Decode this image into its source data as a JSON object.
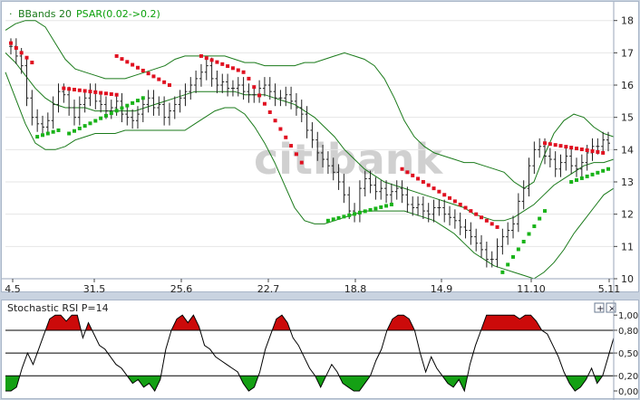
{
  "legend": {
    "dot": "·",
    "bbands_label": "BBands 20",
    "psar_label": "PSAR(0.02->0.2)",
    "bbands_color": "#1a7a1a",
    "psar_color": "#0aa00a"
  },
  "watermark": "citibank",
  "osc_title": "Stochastic RSI P=14",
  "osc_buttons": [
    "+",
    "×"
  ],
  "chart_data": [
    {
      "type": "candlestick",
      "indicators": [
        "Bollinger Bands (20)",
        "Parabolic SAR (0.02->0.2)"
      ],
      "x_ticks": [
        "4.5",
        "31.5",
        "25.6",
        "22.7",
        "18.8",
        "14.9",
        "11.10",
        "5.11"
      ],
      "y_ticks": [
        10,
        11,
        12,
        13,
        14,
        15,
        16,
        17,
        18
      ],
      "ylim": [
        10,
        18.3
      ],
      "grid": false,
      "colors": {
        "band": "#1a7a1a",
        "bar": "#222222",
        "psar_above": "#e01020",
        "psar_below": "#19b319",
        "grid": "#e6e6e6"
      },
      "price": [
        17.2,
        16.9,
        16.6,
        15.6,
        15.0,
        14.8,
        14.7,
        14.9,
        15.4,
        15.8,
        15.7,
        15.3,
        15.0,
        15.4,
        15.6,
        15.8,
        15.5,
        15.4,
        15.2,
        15.3,
        15.5,
        15.1,
        15.0,
        14.9,
        15.1,
        15.4,
        15.6,
        15.3,
        15.4,
        15.0,
        15.2,
        15.4,
        15.6,
        15.8,
        16.0,
        16.2,
        16.4,
        16.6,
        16.2,
        16.0,
        16.1,
        15.9,
        15.9,
        16.0,
        15.8,
        15.7,
        15.7,
        15.9,
        16.0,
        15.8,
        15.6,
        15.6,
        15.7,
        15.5,
        15.3,
        15.1,
        14.6,
        14.3,
        13.9,
        13.7,
        13.5,
        13.3,
        13.0,
        12.6,
        12.1,
        12.0,
        12.8,
        13.1,
        12.9,
        12.7,
        12.8,
        12.6,
        12.7,
        12.8,
        12.6,
        12.3,
        12.2,
        12.3,
        12.1,
        12.0,
        12.2,
        12.2,
        12.0,
        11.9,
        11.8,
        11.6,
        11.5,
        11.3,
        11.1,
        10.9,
        10.6,
        10.6,
        11.0,
        11.3,
        11.5,
        11.7,
        12.4,
        12.8,
        13.5,
        14.0,
        14.1,
        13.8,
        13.7,
        13.4,
        13.6,
        13.8,
        13.5,
        13.4,
        13.6,
        13.9,
        14.1,
        14.1,
        14.3,
        14.2
      ],
      "upper_band": [
        17.7,
        17.9,
        18.0,
        18.0,
        17.8,
        17.3,
        16.8,
        16.5,
        16.4,
        16.3,
        16.2,
        16.2,
        16.2,
        16.3,
        16.4,
        16.5,
        16.6,
        16.8,
        16.9,
        16.9,
        16.9,
        16.9,
        16.9,
        16.8,
        16.7,
        16.7,
        16.6,
        16.6,
        16.6,
        16.6,
        16.7,
        16.7,
        16.8,
        16.9,
        17.0,
        16.9,
        16.8,
        16.6,
        16.2,
        15.6,
        14.9,
        14.4,
        14.1,
        13.9,
        13.8,
        13.7,
        13.6,
        13.6,
        13.5,
        13.4,
        13.3,
        13.0,
        12.8,
        13.0,
        13.8,
        14.5,
        14.9,
        15.1,
        15.0,
        14.7,
        14.5,
        14.4
      ],
      "middle_band": [
        17.0,
        16.7,
        16.3,
        15.9,
        15.6,
        15.4,
        15.3,
        15.3,
        15.3,
        15.2,
        15.2,
        15.2,
        15.2,
        15.2,
        15.3,
        15.4,
        15.5,
        15.6,
        15.7,
        15.8,
        15.8,
        15.8,
        15.8,
        15.8,
        15.7,
        15.7,
        15.7,
        15.6,
        15.5,
        15.4,
        15.2,
        15.0,
        14.7,
        14.4,
        14.0,
        13.7,
        13.4,
        13.2,
        13.0,
        12.9,
        12.8,
        12.7,
        12.6,
        12.5,
        12.4,
        12.3,
        12.2,
        12.0,
        11.9,
        11.8,
        11.8,
        11.9,
        12.1,
        12.3,
        12.6,
        12.9,
        13.1,
        13.3,
        13.5,
        13.6,
        13.6,
        13.7
      ],
      "lower_band": [
        16.4,
        15.6,
        14.8,
        14.2,
        14.0,
        14.0,
        14.1,
        14.3,
        14.4,
        14.5,
        14.5,
        14.5,
        14.6,
        14.6,
        14.6,
        14.6,
        14.6,
        14.6,
        14.6,
        14.8,
        15.0,
        15.2,
        15.3,
        15.3,
        15.1,
        14.7,
        14.2,
        13.6,
        12.9,
        12.2,
        11.8,
        11.7,
        11.7,
        11.8,
        11.9,
        12.0,
        12.1,
        12.1,
        12.1,
        12.1,
        12.1,
        12.0,
        11.9,
        11.8,
        11.6,
        11.4,
        11.1,
        10.8,
        10.6,
        10.4,
        10.3,
        10.2,
        10.1,
        10.0,
        10.2,
        10.5,
        10.9,
        11.4,
        11.8,
        12.2,
        12.6,
        12.8
      ],
      "psar": [
        {
          "start": 0,
          "end": 4,
          "side": "above",
          "from": 17.3,
          "to": 16.7
        },
        {
          "start": 5,
          "end": 9,
          "side": "below",
          "from": 14.4,
          "to": 14.6
        },
        {
          "start": 10,
          "end": 20,
          "side": "above",
          "from": 15.9,
          "to": 15.7
        },
        {
          "start": 11,
          "end": 25,
          "side": "below",
          "from": 14.5,
          "to": 15.6
        },
        {
          "start": 20,
          "end": 30,
          "side": "above",
          "from": 16.9,
          "to": 16.0
        },
        {
          "start": 36,
          "end": 44,
          "side": "above",
          "from": 16.9,
          "to": 16.4
        },
        {
          "start": 45,
          "end": 55,
          "side": "above",
          "from": 16.2,
          "to": 13.6
        },
        {
          "start": 60,
          "end": 72,
          "side": "below",
          "from": 11.8,
          "to": 12.3
        },
        {
          "start": 74,
          "end": 92,
          "side": "above",
          "from": 13.4,
          "to": 11.6
        },
        {
          "start": 93,
          "end": 101,
          "side": "below",
          "from": 10.2,
          "to": 12.1
        },
        {
          "start": 101,
          "end": 112,
          "side": "above",
          "from": 14.2,
          "to": 13.9
        },
        {
          "start": 106,
          "end": 113,
          "side": "below",
          "from": 13.0,
          "to": 13.4
        }
      ]
    },
    {
      "type": "line",
      "title": "Stochastic RSI P=14",
      "y_ticks": [
        "0,00",
        "0,20",
        "0,50",
        "0,80",
        "1,00"
      ],
      "ylim": [
        0,
        1.05
      ],
      "levels": [
        0.2,
        0.5,
        0.8
      ],
      "colors": {
        "line": "#000000",
        "over": "#cc0a0a",
        "under": "#14a014",
        "level": "#000000"
      },
      "values": [
        0.0,
        0.0,
        0.05,
        0.3,
        0.5,
        0.35,
        0.55,
        0.75,
        0.95,
        1.0,
        1.0,
        0.92,
        1.0,
        1.0,
        0.7,
        0.9,
        0.75,
        0.6,
        0.55,
        0.45,
        0.35,
        0.3,
        0.2,
        0.1,
        0.15,
        0.05,
        0.1,
        0.0,
        0.15,
        0.55,
        0.8,
        0.95,
        1.0,
        0.9,
        1.0,
        0.85,
        0.6,
        0.55,
        0.45,
        0.4,
        0.35,
        0.3,
        0.25,
        0.1,
        0.0,
        0.05,
        0.25,
        0.55,
        0.75,
        0.95,
        1.0,
        0.9,
        0.7,
        0.6,
        0.45,
        0.3,
        0.2,
        0.05,
        0.2,
        0.35,
        0.25,
        0.1,
        0.05,
        0.0,
        0.0,
        0.1,
        0.2,
        0.4,
        0.55,
        0.8,
        0.95,
        1.0,
        1.0,
        0.95,
        0.8,
        0.5,
        0.25,
        0.45,
        0.3,
        0.2,
        0.1,
        0.05,
        0.15,
        0.0,
        0.35,
        0.6,
        0.8,
        1.0,
        1.0,
        1.0,
        1.0,
        1.0,
        1.0,
        0.95,
        1.0,
        1.0,
        0.92,
        0.8,
        0.75,
        0.6,
        0.45,
        0.25,
        0.1,
        0.0,
        0.05,
        0.15,
        0.3,
        0.1,
        0.2,
        0.45,
        0.7
      ]
    }
  ]
}
